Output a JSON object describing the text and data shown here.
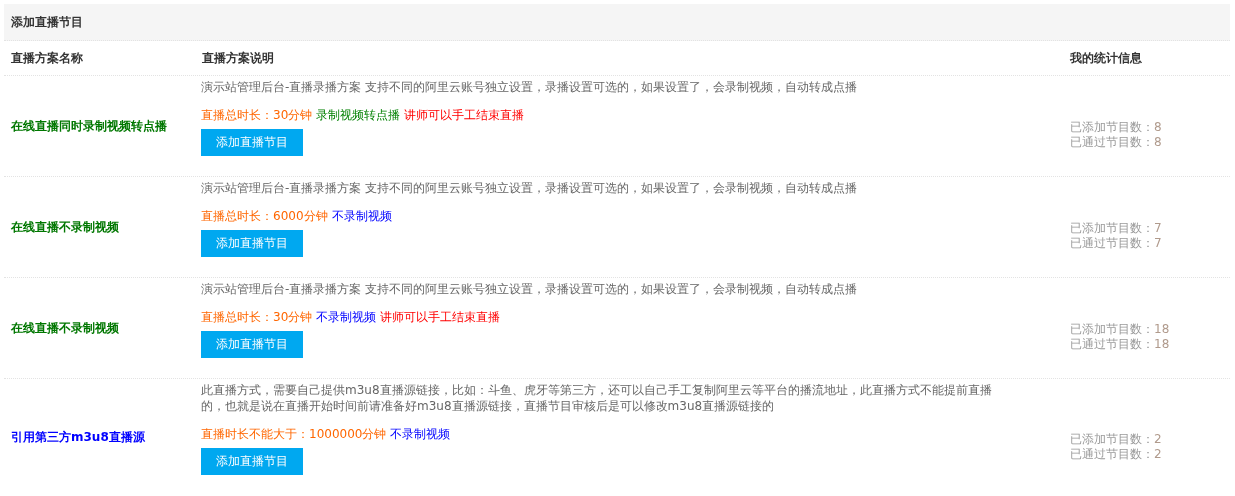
{
  "panel": {
    "title": "添加直播节目"
  },
  "table": {
    "columns": [
      "直播方案名称",
      "直播方案说明",
      "我的统计信息"
    ],
    "rows": [
      {
        "name": "在线直播同时录制视频转点播",
        "kind": "live",
        "description": "演示站管理后台-直播录播方案 支持不同的阿里云账号独立设置，录播设置可选的，如果设置了，会录制视频，自动转成点播",
        "tags": [
          {
            "kind": "duration",
            "label": "直播总时长：",
            "value": "30分钟"
          },
          {
            "kind": "record",
            "label": "录制视频转点播"
          },
          {
            "kind": "manual-end",
            "label": "讲师可以手工结束直播"
          }
        ],
        "button": "添加直播节目",
        "stats": [
          {
            "label": "已添加节目数：",
            "value": "8"
          },
          {
            "label": "已通过节目数：",
            "value": "8"
          }
        ]
      },
      {
        "name": "在线直播不录制视频",
        "kind": "live",
        "description": "演示站管理后台-直播录播方案 支持不同的阿里云账号独立设置，录播设置可选的，如果设置了，会录制视频，自动转成点播",
        "tags": [
          {
            "kind": "duration",
            "label": "直播总时长：",
            "value": "6000分钟"
          },
          {
            "kind": "no-record",
            "label": "不录制视频"
          }
        ],
        "button": "添加直播节目",
        "stats": [
          {
            "label": "已添加节目数：",
            "value": "7"
          },
          {
            "label": "已通过节目数：",
            "value": "7"
          }
        ]
      },
      {
        "name": "在线直播不录制视频",
        "kind": "live",
        "description": "演示站管理后台-直播录播方案 支持不同的阿里云账号独立设置，录播设置可选的，如果设置了，会录制视频，自动转成点播",
        "tags": [
          {
            "kind": "duration",
            "label": "直播总时长：",
            "value": "30分钟"
          },
          {
            "kind": "no-record",
            "label": "不录制视频"
          },
          {
            "kind": "manual-end",
            "label": "讲师可以手工结束直播"
          }
        ],
        "button": "添加直播节目",
        "stats": [
          {
            "label": "已添加节目数：",
            "value": "18"
          },
          {
            "label": "已通过节目数：",
            "value": "18"
          }
        ]
      },
      {
        "name": "引用第三方m3u8直播源",
        "kind": "external",
        "description": "此直播方式，需要自己提供m3u8直播源链接，比如：斗鱼、虎牙等第三方，还可以自己手工复制阿里云等平台的播流地址，此直播方式不能提前直播的，也就是说在直播开始时间前请准备好m3u8直播源链接，直播节目审核后是可以修改m3u8直播源链接的",
        "tags": [
          {
            "kind": "duration",
            "label": "直播时长不能大于：",
            "value": "1000000分钟"
          },
          {
            "kind": "no-record",
            "label": "不录制视频"
          }
        ],
        "button": "添加直播节目",
        "stats": [
          {
            "label": "已添加节目数：",
            "value": "2"
          },
          {
            "label": "已通过节目数：",
            "value": "2"
          }
        ]
      }
    ]
  }
}
